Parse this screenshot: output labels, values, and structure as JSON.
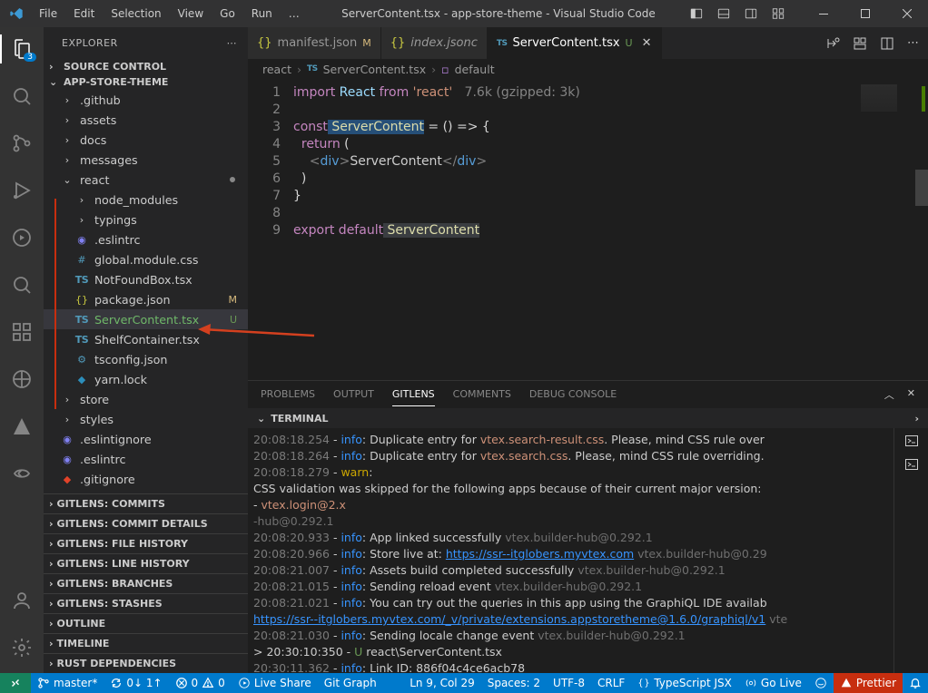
{
  "title": "ServerContent.tsx - app-store-theme - Visual Studio Code",
  "menu": [
    "File",
    "Edit",
    "Selection",
    "View",
    "Go",
    "Run",
    "…"
  ],
  "activity_badge": "3",
  "explorer": {
    "title": "EXPLORER",
    "sections": {
      "source_control": "SOURCE CONTROL",
      "workspace": "APP-STORE-THEME",
      "items": [
        {
          "name": ".github",
          "type": "folder",
          "depth": 1
        },
        {
          "name": "assets",
          "type": "folder",
          "depth": 1
        },
        {
          "name": "docs",
          "type": "folder",
          "depth": 1
        },
        {
          "name": "messages",
          "type": "folder",
          "depth": 1
        },
        {
          "name": "react",
          "type": "folder",
          "depth": 1,
          "open": true,
          "dirty": true
        },
        {
          "name": "node_modules",
          "type": "folder",
          "depth": 2
        },
        {
          "name": "typings",
          "type": "folder",
          "depth": 2
        },
        {
          "name": ".eslintrc",
          "type": "file",
          "depth": 2,
          "icon": "eslint"
        },
        {
          "name": "global.module.css",
          "type": "file",
          "depth": 2,
          "icon": "hash"
        },
        {
          "name": "NotFoundBox.tsx",
          "type": "file",
          "depth": 2,
          "icon": "ts"
        },
        {
          "name": "package.json",
          "type": "file",
          "depth": 2,
          "icon": "json",
          "status": "M"
        },
        {
          "name": "ServerContent.tsx",
          "type": "file",
          "depth": 2,
          "icon": "ts",
          "status": "U",
          "active": true
        },
        {
          "name": "ShelfContainer.tsx",
          "type": "file",
          "depth": 2,
          "icon": "ts"
        },
        {
          "name": "tsconfig.json",
          "type": "file",
          "depth": 2,
          "icon": "tsconfig"
        },
        {
          "name": "yarn.lock",
          "type": "file",
          "depth": 2,
          "icon": "yarn"
        },
        {
          "name": "store",
          "type": "folder",
          "depth": 1
        },
        {
          "name": "styles",
          "type": "folder",
          "depth": 1
        },
        {
          "name": ".eslintignore",
          "type": "file",
          "depth": 1,
          "icon": "eslint"
        },
        {
          "name": ".eslintrc",
          "type": "file",
          "depth": 1,
          "icon": "eslint"
        },
        {
          "name": ".gitignore",
          "type": "file",
          "depth": 1,
          "icon": "git"
        }
      ],
      "bottom_sections": [
        "GITLENS: COMMITS",
        "GITLENS: COMMIT DETAILS",
        "GITLENS: FILE HISTORY",
        "GITLENS: LINE HISTORY",
        "GITLENS: BRANCHES",
        "GITLENS: STASHES",
        "OUTLINE",
        "TIMELINE",
        "RUST DEPENDENCIES"
      ]
    }
  },
  "tabs": [
    {
      "label": "manifest.json",
      "icon": "json",
      "suffix": "M",
      "suffix_class": "mod-m"
    },
    {
      "label": "index.jsonc",
      "icon": "json",
      "italic": true
    },
    {
      "label": "ServerContent.tsx",
      "icon": "ts",
      "suffix": "U",
      "suffix_class": "unt-u",
      "active": true,
      "close": true
    }
  ],
  "breadcrumb": {
    "p1": "react",
    "p2": "ServerContent.tsx",
    "p3": "default"
  },
  "code": {
    "lines": {
      "l1a": "import",
      "l1b": " React ",
      "l1c": "from",
      "l1d": " 'react'",
      "l1e": "   7.6k (gzipped: 3k)",
      "l3a": "const",
      "l3b": " ServerContent",
      "l3c": " = () => {",
      "l4a": "  return",
      "l4b": " (",
      "l5a": "    <",
      "l5b": "div",
      "l5c": ">",
      "l5d": "ServerContent",
      "l5e": "</",
      "l5f": "div",
      "l5g": ">",
      "l6": "  )",
      "l7": "}",
      "l9a": "export",
      "l9b": " default",
      "l9c": " ServerContent"
    }
  },
  "panel": {
    "tabs": [
      "PROBLEMS",
      "OUTPUT",
      "GITLENS",
      "COMMENTS",
      "DEBUG CONSOLE"
    ],
    "active_tab": 2,
    "terminal_label": "TERMINAL",
    "log": [
      {
        "t": "20:08:18.254",
        "level": "info",
        "msg_a": ": Duplicate entry for ",
        "msg_b": "vtex.search-result.css",
        "msg_c": ". Please, mind CSS rule over"
      },
      {
        "t": "20:08:18.264",
        "level": "info",
        "msg_a": ": Duplicate entry for ",
        "msg_b": "vtex.search.css",
        "msg_c": ". Please, mind CSS rule overriding."
      },
      {
        "t": "20:08:18.279",
        "level": "warn",
        "msg_a": ":"
      },
      {
        "plain": "CSS validation was skipped for the following apps because of their current major version:"
      },
      {
        "plain": ""
      },
      {
        "plain_a": "- ",
        "plain_b": "vtex.login@2.x",
        "cls": "t-str"
      },
      {
        "plain": "-hub@0.292.1",
        "cls": "t-dim"
      },
      {
        "t": "20:08:20.933",
        "level": "info",
        "msg_a": ": App linked successfully ",
        "dim": "vtex.builder-hub@0.292.1"
      },
      {
        "t": "20:08:20.966",
        "level": "info",
        "msg_a": ": Store live at: ",
        "link": "https://ssr--itglobers.myvtex.com",
        "dim": " vtex.builder-hub@0.29"
      },
      {
        "t": "20:08:21.007",
        "level": "info",
        "msg_a": ": Assets build completed successfully ",
        "dim": "vtex.builder-hub@0.292.1"
      },
      {
        "t": "20:08:21.015",
        "level": "info",
        "msg_a": ": Sending reload event ",
        "dim": "vtex.builder-hub@0.292.1"
      },
      {
        "t": "20:08:21.021",
        "level": "info",
        "msg_a": ": You can try out the queries in this app using the GraphiQL IDE availab"
      },
      {
        "link": "https://ssr--itglobers.myvtex.com/_v/private/extensions.appstoretheme@1.6.0/graphiql/v1",
        "dim": " vte"
      },
      {
        "t": "20:08:21.030",
        "level": "info",
        "msg_a": ": Sending locale change event ",
        "dim": "vtex.builder-hub@0.292.1"
      },
      {
        "prompt": "> 20:30:10:350 - ",
        "u": "U",
        "path": " react\\ServerContent.tsx"
      },
      {
        "t": "20:30:11.362",
        "level": "info",
        "msg_a": ": Link ID: 886f04c4ce6acb78"
      }
    ]
  },
  "status": {
    "branch": "master*",
    "sync": "0↓ 1↑",
    "errors": "0",
    "warnings": "0",
    "liveshare": "Live Share",
    "gitgraph": "Git Graph",
    "pos": "Ln 9, Col 29",
    "spaces": "Spaces: 2",
    "enc": "UTF-8",
    "eol": "CRLF",
    "lang": "TypeScript JSX",
    "golive": "Go Live",
    "prettier": "Prettier"
  }
}
